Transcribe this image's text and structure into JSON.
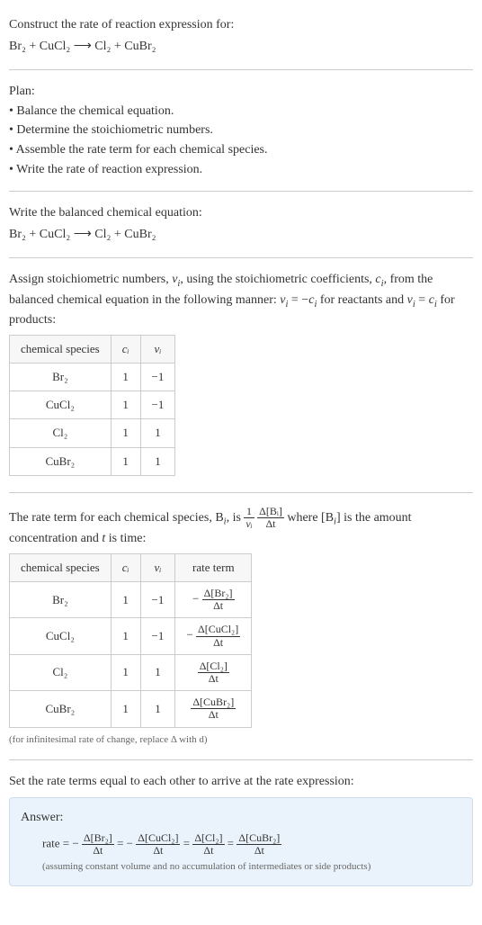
{
  "header": {
    "construct": "Construct the rate of reaction expression for:",
    "equation": "Br₂ + CuCl₂ ⟶ Cl₂ + CuBr₂"
  },
  "plan": {
    "title": "Plan:",
    "items": [
      "• Balance the chemical equation.",
      "• Determine the stoichiometric numbers.",
      "• Assemble the rate term for each chemical species.",
      "• Write the rate of reaction expression."
    ]
  },
  "balanced": {
    "intro": "Write the balanced chemical equation:",
    "equation": "Br₂ + CuCl₂ ⟶ Cl₂ + CuBr₂"
  },
  "assign": {
    "text1": "Assign stoichiometric numbers, ",
    "nu_i": "ν",
    "text2": ", using the stoichiometric coefficients, ",
    "c_i": "c",
    "text3": ", from the balanced chemical equation in the following manner: ",
    "rule_reactants": " = −",
    "text4": " for reactants and ",
    "rule_products": " = ",
    "text5": " for products:"
  },
  "table1": {
    "headers": {
      "species": "chemical species",
      "c": "cᵢ",
      "nu": "νᵢ"
    },
    "rows": [
      {
        "species": "Br₂",
        "c": "1",
        "nu": "−1"
      },
      {
        "species": "CuCl₂",
        "c": "1",
        "nu": "−1"
      },
      {
        "species": "Cl₂",
        "c": "1",
        "nu": "1"
      },
      {
        "species": "CuBr₂",
        "c": "1",
        "nu": "1"
      }
    ]
  },
  "rate_term": {
    "pre": "The rate term for each chemical species, B",
    "mid": ", is ",
    "frac1_num": "1",
    "frac1_den": "νᵢ",
    "frac2_num": "Δ[Bᵢ]",
    "frac2_den": "Δt",
    "post1": " where [B",
    "post2": "] is the amount concentration and ",
    "t": "t",
    "post3": " is time:"
  },
  "table2": {
    "headers": {
      "species": "chemical species",
      "c": "cᵢ",
      "nu": "νᵢ",
      "rate": "rate term"
    },
    "rows": [
      {
        "species": "Br₂",
        "c": "1",
        "nu": "−1",
        "neg": "−",
        "num": "Δ[Br₂]",
        "den": "Δt"
      },
      {
        "species": "CuCl₂",
        "c": "1",
        "nu": "−1",
        "neg": "−",
        "num": "Δ[CuCl₂]",
        "den": "Δt"
      },
      {
        "species": "Cl₂",
        "c": "1",
        "nu": "1",
        "neg": "",
        "num": "Δ[Cl₂]",
        "den": "Δt"
      },
      {
        "species": "CuBr₂",
        "c": "1",
        "nu": "1",
        "neg": "",
        "num": "Δ[CuBr₂]",
        "den": "Δt"
      }
    ]
  },
  "note_infinitesimal": "(for infinitesimal rate of change, replace Δ with d)",
  "set_equal": "Set the rate terms equal to each other to arrive at the rate expression:",
  "answer": {
    "label": "Answer:",
    "rate_prefix": "rate = −",
    "f1_num": "Δ[Br₂]",
    "f1_den": "Δt",
    "eq1": " = −",
    "f2_num": "Δ[CuCl₂]",
    "f2_den": "Δt",
    "eq2": " = ",
    "f3_num": "Δ[Cl₂]",
    "f3_den": "Δt",
    "eq3": " = ",
    "f4_num": "Δ[CuBr₂]",
    "f4_den": "Δt",
    "assume": "(assuming constant volume and no accumulation of intermediates or side products)"
  },
  "chart_data": {
    "type": "table",
    "title": "Stoichiometric numbers and rate terms",
    "tables": [
      {
        "columns": [
          "chemical species",
          "c_i",
          "ν_i"
        ],
        "rows": [
          [
            "Br2",
            1,
            -1
          ],
          [
            "CuCl2",
            1,
            -1
          ],
          [
            "Cl2",
            1,
            1
          ],
          [
            "CuBr2",
            1,
            1
          ]
        ]
      },
      {
        "columns": [
          "chemical species",
          "c_i",
          "ν_i",
          "rate term"
        ],
        "rows": [
          [
            "Br2",
            1,
            -1,
            "-Δ[Br2]/Δt"
          ],
          [
            "CuCl2",
            1,
            -1,
            "-Δ[CuCl2]/Δt"
          ],
          [
            "Cl2",
            1,
            1,
            "Δ[Cl2]/Δt"
          ],
          [
            "CuBr2",
            1,
            1,
            "Δ[CuBr2]/Δt"
          ]
        ]
      }
    ],
    "rate_expression": "rate = -Δ[Br2]/Δt = -Δ[CuCl2]/Δt = Δ[Cl2]/Δt = Δ[CuBr2]/Δt"
  }
}
